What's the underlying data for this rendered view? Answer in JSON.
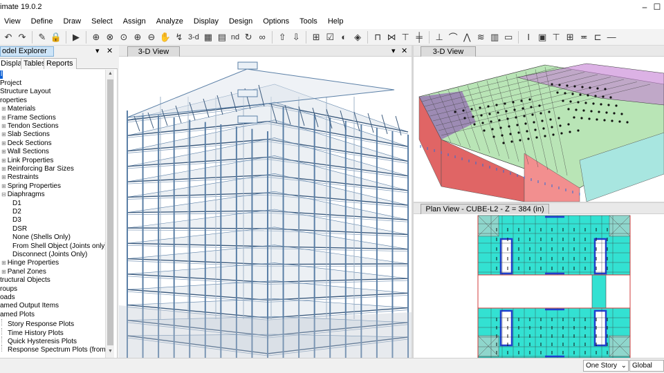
{
  "window": {
    "title": "imate 19.0.2",
    "minimize": "–",
    "maximize": "☐"
  },
  "menu": [
    "View",
    "Define",
    "Draw",
    "Select",
    "Assign",
    "Analyze",
    "Display",
    "Design",
    "Options",
    "Tools",
    "Help"
  ],
  "toolbar": {
    "view_3d_label": "3-d",
    "nd_label": "nd"
  },
  "explorer": {
    "title": "odel Explorer",
    "pin": "▾",
    "close": "✕",
    "tabs": [
      "Display",
      "Tables",
      "Reports"
    ],
    "selected_root": "l",
    "tree": [
      {
        "label": "Project",
        "depth": 0,
        "expander": ""
      },
      {
        "label": "Structure Layout",
        "depth": 0,
        "expander": ""
      },
      {
        "label": "roperties",
        "depth": 0,
        "expander": ""
      },
      {
        "label": "Materials",
        "depth": 1,
        "expander": "⊞"
      },
      {
        "label": "Frame Sections",
        "depth": 1,
        "expander": "⊞"
      },
      {
        "label": "Tendon Sections",
        "depth": 1,
        "expander": "⊞"
      },
      {
        "label": "Slab Sections",
        "depth": 1,
        "expander": "⊞"
      },
      {
        "label": "Deck Sections",
        "depth": 1,
        "expander": "⊞"
      },
      {
        "label": "Wall Sections",
        "depth": 1,
        "expander": "⊞"
      },
      {
        "label": "Link Properties",
        "depth": 1,
        "expander": "⊞"
      },
      {
        "label": "Reinforcing Bar Sizes",
        "depth": 1,
        "expander": "⊞"
      },
      {
        "label": "Restraints",
        "depth": 1,
        "expander": "⊞"
      },
      {
        "label": "Spring Properties",
        "depth": 1,
        "expander": "⊞"
      },
      {
        "label": "Diaphragms",
        "depth": 1,
        "expander": "⊟"
      },
      {
        "label": "D1",
        "depth": 2,
        "expander": ""
      },
      {
        "label": "D2",
        "depth": 2,
        "expander": ""
      },
      {
        "label": "D3",
        "depth": 2,
        "expander": ""
      },
      {
        "label": "DSR",
        "depth": 2,
        "expander": ""
      },
      {
        "label": "None (Shells Only)",
        "depth": 2,
        "expander": ""
      },
      {
        "label": "From Shell Object (Joints only)",
        "depth": 2,
        "expander": ""
      },
      {
        "label": "Disconnect (Joints Only)",
        "depth": 2,
        "expander": ""
      },
      {
        "label": "Hinge Properties",
        "depth": 1,
        "expander": "⊞"
      },
      {
        "label": "Panel Zones",
        "depth": 1,
        "expander": "⊞"
      },
      {
        "label": "tructural Objects",
        "depth": 0,
        "expander": ""
      },
      {
        "label": "roups",
        "depth": 0,
        "expander": ""
      },
      {
        "label": "oads",
        "depth": 0,
        "expander": ""
      },
      {
        "label": "amed Output Items",
        "depth": 0,
        "expander": ""
      },
      {
        "label": "amed Plots",
        "depth": 0,
        "expander": ""
      },
      {
        "label": "Story Response Plots",
        "depth": 1,
        "expander": ""
      },
      {
        "label": "Time History Plots",
        "depth": 1,
        "expander": ""
      },
      {
        "label": "Quick Hysteresis Plots",
        "depth": 1,
        "expander": ""
      },
      {
        "label": "Response Spectrum Plots (from TH)",
        "depth": 1,
        "expander": ""
      }
    ]
  },
  "views": {
    "left_3d": {
      "tab": "3-D View",
      "pin": "▾",
      "close": "✕"
    },
    "right_3d": {
      "tab": "3-D View"
    },
    "plan": {
      "tab": "Plan View - CUBE-L2 - Z = 384 (in)"
    }
  },
  "status": {
    "story": "One Story",
    "coords": "Global"
  },
  "colors": {
    "accent": "#cde4f7",
    "steel": "#5a7fa6",
    "plan_slab": "#33e1d2",
    "wall_red": "#e06565"
  }
}
